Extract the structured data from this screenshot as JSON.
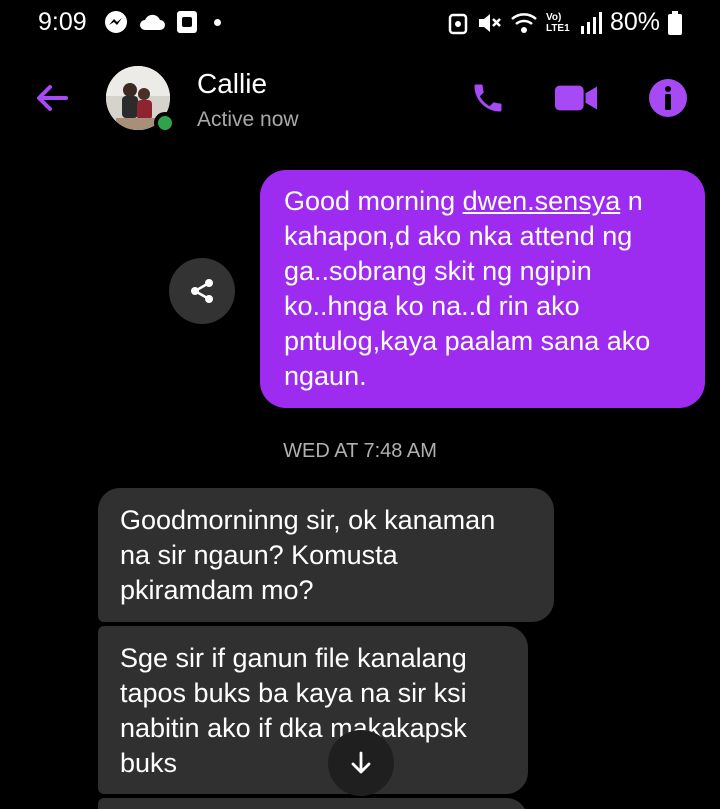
{
  "status_bar": {
    "time": "9:09",
    "battery": "80%",
    "network": "Vo) LTE1"
  },
  "header": {
    "contact_name": "Callie",
    "status": "Active now",
    "accent_color": "#a74af5"
  },
  "messages": {
    "outgoing": {
      "lines": [
        [
          "Good morning ",
          "dwen.sensya",
          " n"
        ],
        "kahapon,d ako nka attend ng",
        "ga..sobrang skit ng ngipin",
        "ko..hnga ko na..d rin ako",
        "pntulog,kaya paalam sana ako",
        "ngaun."
      ],
      "color": "#9d2cf0"
    },
    "timestamp": "WED AT 7:48 AM",
    "incoming": [
      {
        "lines": [
          "Goodmorninng sir, ok kanaman",
          "na sir ngaun? Komusta",
          "pkiramdam mo?"
        ]
      },
      {
        "lines": [
          "Sge sir if ganun file kanalang",
          "tapos buks ba kaya na sir ksi",
          "nabitin ako if dka makakapsk",
          "buks"
        ]
      }
    ]
  },
  "icons": [
    "back-arrow-icon",
    "phone-icon",
    "video-camera-icon",
    "info-icon",
    "share-icon",
    "arrow-down-icon"
  ]
}
